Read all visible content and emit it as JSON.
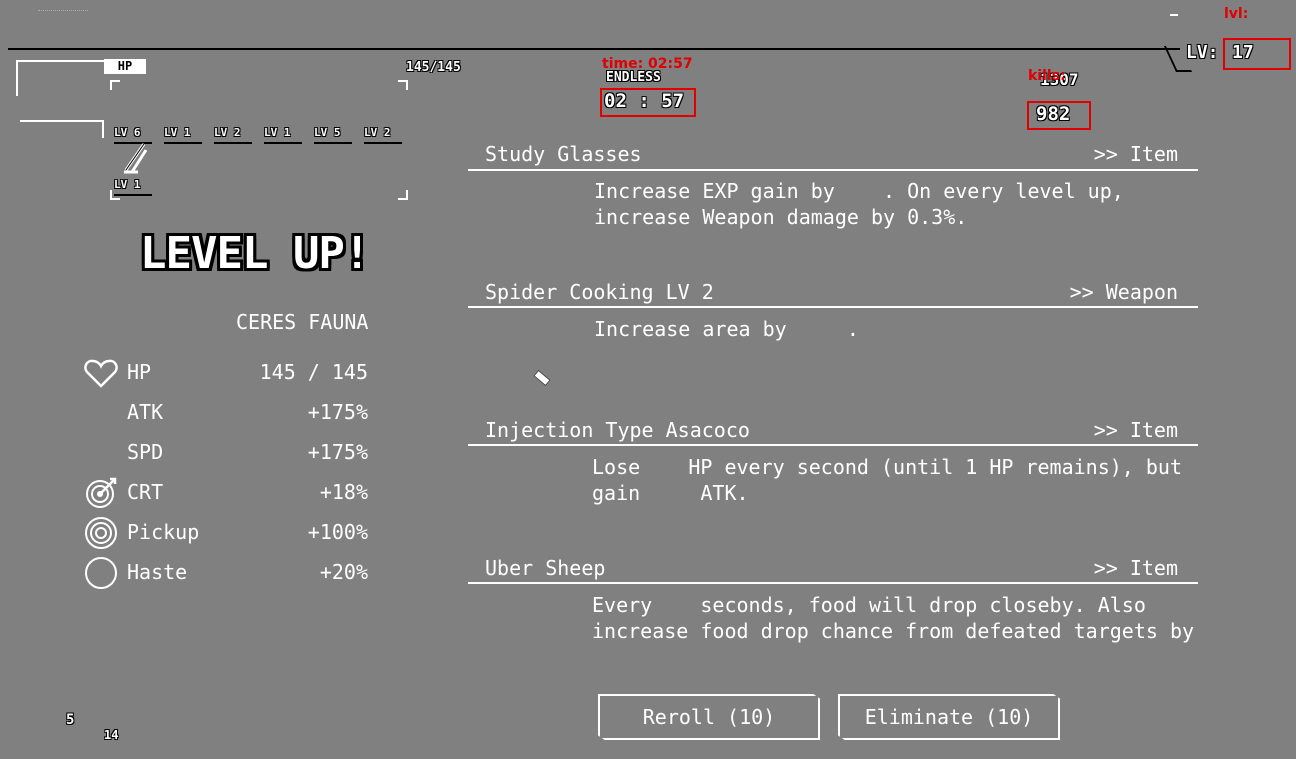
{
  "hud": {
    "hp_label": "HP",
    "hp_value": "145/145",
    "time_annotation": "time:  02:57",
    "mode_label": "ENDLESS",
    "timer": "02 : 57",
    "kills_annotation": "kills:",
    "kills_hidden": "1307",
    "kills_value": "982",
    "level_annotation": "lvl:",
    "level_prefix": "LV:",
    "level_value": "17",
    "hp_fill_fraction": 1.0
  },
  "weapons": [
    {
      "label": "LV 6"
    },
    {
      "label": "LV 1"
    },
    {
      "label": "LV 2"
    },
    {
      "label": "LV 1"
    },
    {
      "label": "LV 5"
    },
    {
      "label": "LV 2"
    }
  ],
  "extra_slot_label": "LV 1",
  "level_up_title": "LEVEL UP!",
  "character_name": "CERES FAUNA",
  "stats": [
    {
      "icon": "heart-icon",
      "name": "HP",
      "value": "145 / 145"
    },
    {
      "icon": "",
      "name": "ATK",
      "value": "+175%"
    },
    {
      "icon": "",
      "name": "SPD",
      "value": "+175%"
    },
    {
      "icon": "crit-target-icon",
      "name": "CRT",
      "value": "+18%"
    },
    {
      "icon": "pickup-rings-icon",
      "name": "Pickup",
      "value": "+100%"
    },
    {
      "icon": "haste-circle-icon",
      "name": "Haste",
      "value": "+20%"
    }
  ],
  "cards": [
    {
      "title": "Study Glasses",
      "type": ">> Item",
      "desc": "Increase EXP gain by    . On every level up,\nincrease Weapon damage by 0.3%."
    },
    {
      "title": "Spider Cooking LV 2",
      "type": ">> Weapon",
      "desc": "Increase area by     ."
    },
    {
      "title": "Injection Type Asacoco",
      "type": ">> Item",
      "desc": "Lose    HP every second (until 1 HP remains), but\ngain     ATK."
    },
    {
      "title": "Uber Sheep",
      "type": ">> Item",
      "desc": "Every    seconds, food will drop closeby. Also\nincrease food drop chance from defeated targets by"
    }
  ],
  "buttons": {
    "reroll": "Reroll (10)",
    "eliminate": "Eliminate (10)"
  },
  "bottom_left": {
    "count_a": "5",
    "count_b": "14"
  },
  "colors": {
    "background": "#808080",
    "annotation_red": "#e00000",
    "text": "#ffffff",
    "outline": "#000000"
  }
}
